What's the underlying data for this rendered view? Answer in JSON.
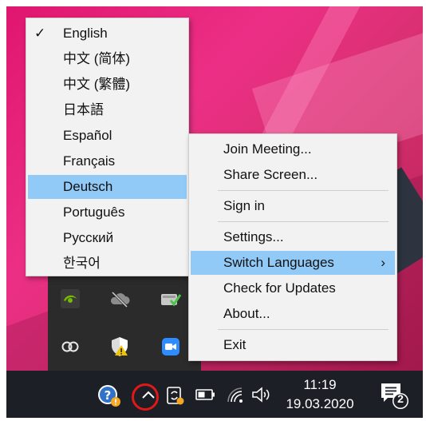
{
  "language_menu": {
    "items": [
      {
        "label": "English",
        "checked": true
      },
      {
        "label": "中文 (简体)"
      },
      {
        "label": "中文 (繁體)"
      },
      {
        "label": "日本語"
      },
      {
        "label": "Español"
      },
      {
        "label": "Français"
      },
      {
        "label": "Deutsch",
        "highlighted": true
      },
      {
        "label": "Português"
      },
      {
        "label": "Русский"
      },
      {
        "label": "한국어"
      }
    ],
    "check_glyph": "✓"
  },
  "context_menu": {
    "items": [
      {
        "label": "Join Meeting..."
      },
      {
        "label": "Share Screen..."
      },
      {
        "label": "Sign in"
      },
      {
        "label": "Settings..."
      },
      {
        "label": "Switch Languages",
        "highlighted": true,
        "has_submenu": true
      },
      {
        "label": "Check for Updates"
      },
      {
        "label": "About..."
      },
      {
        "label": "Exit"
      }
    ],
    "submenu_glyph": "›"
  },
  "taskbar": {
    "time": "11:19",
    "date": "19.03.2020",
    "notification_count": "2"
  },
  "colors": {
    "highlight": "#91c9f7",
    "menu_bg": "#f2f2f2",
    "taskbar_bg": "#1c1f26",
    "annotation_ring": "#e01818"
  }
}
